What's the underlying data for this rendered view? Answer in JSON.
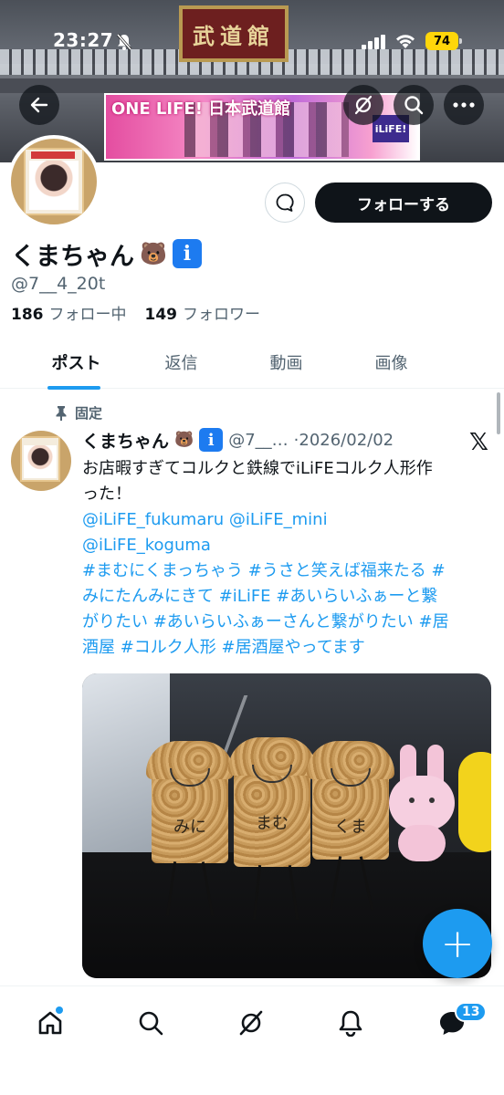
{
  "status_bar": {
    "time": "23:27",
    "battery": "74"
  },
  "banner": {
    "sign_text": "武道館",
    "poster_text": "ONE LIFE! 日本武道館",
    "poster_logo": "iLiFE!"
  },
  "profile": {
    "display_name": "くまちゃん",
    "name_emoji": "🐻",
    "badge": "i",
    "handle": "@7__4_20t",
    "following_count": "186",
    "following_label": "フォロー中",
    "followers_count": "149",
    "followers_label": "フォロワー",
    "follow_button": "フォローする"
  },
  "tabs": [
    "ポスト",
    "返信",
    "動画",
    "画像"
  ],
  "post": {
    "pinned_label": "固定",
    "author_name": "くまちゃん",
    "author_emoji": "🐻",
    "author_badge": "i",
    "author_handle": "@7__…",
    "date": "·2026/02/02",
    "text_line1": "お店暇すぎてコルクと鉄線でiLiFEコルク人形作",
    "text_line2": "った！",
    "mention_line1": "@iLiFE_fukumaru @iLiFE_mini",
    "mention_line2": "@iLiFE_koguma",
    "hashtags_line1": " #まむにくまっちゃう #うさと笑えば福来たる #",
    "hashtags_line2": "みにたんみにきて #iLiFE #あいらいふぁーと繋",
    "hashtags_line3": "がりたい #あいらいふぁーさんと繋がりたい #居",
    "hashtags_line4": "酒屋 #コルク人形 #居酒屋やってます",
    "image_labels": [
      "みに",
      "まむ",
      "くま"
    ]
  },
  "fab_label": "+",
  "bottom_nav": {
    "items": [
      "home-icon",
      "search-icon",
      "grok-icon",
      "notifications-icon",
      "messages-icon"
    ],
    "messages_badge": "13"
  },
  "colors": {
    "accent": "#1d9bf0",
    "text": "#0f1419",
    "secondary": "#536471",
    "verified": "#1d7bf0"
  }
}
